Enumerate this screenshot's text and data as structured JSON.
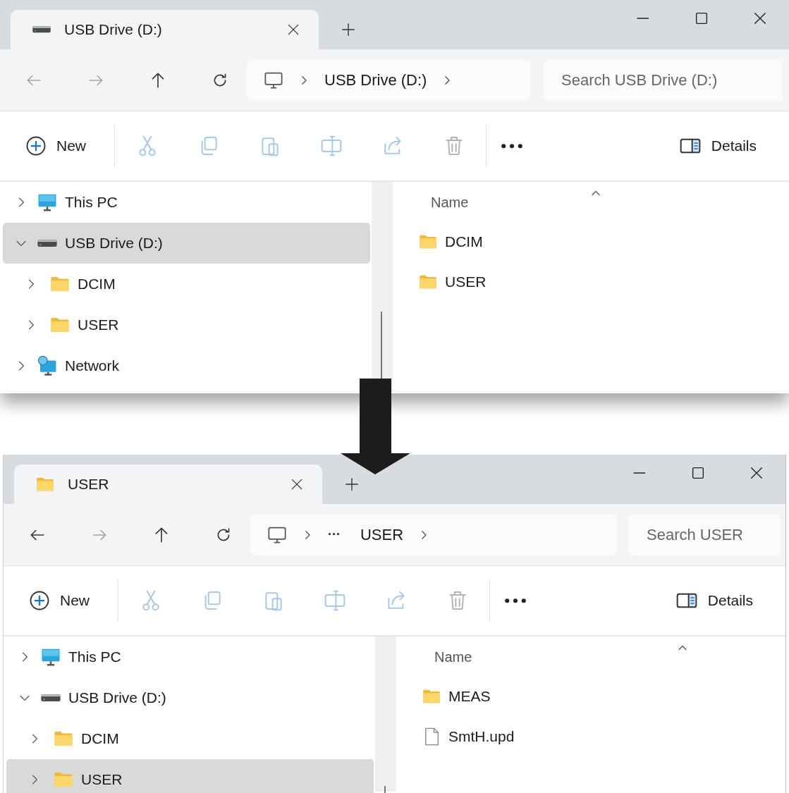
{
  "windows": [
    {
      "tab": {
        "label": "USB Drive (D:)",
        "kind": "drive",
        "selected": true
      },
      "nav_buttons": [
        {
          "kind": "back",
          "disabled": true
        },
        {
          "kind": "forward",
          "disabled": true
        },
        {
          "kind": "up",
          "disabled": false
        },
        {
          "kind": "refresh",
          "disabled": false
        }
      ],
      "address": [
        {
          "kind": "location",
          "label": "USB Drive (D:)"
        }
      ],
      "search": {
        "placeholder": "Search USB Drive (D:)"
      },
      "commands": [
        {
          "kind": "new",
          "label": "New",
          "disabled": false
        },
        {
          "kind": "cut",
          "disabled": true
        },
        {
          "kind": "copy",
          "disabled": true
        },
        {
          "kind": "paste",
          "disabled": true
        },
        {
          "kind": "rename",
          "disabled": true
        },
        {
          "kind": "share",
          "disabled": true
        },
        {
          "kind": "delete",
          "disabled": true
        },
        {
          "kind": "more",
          "disabled": false
        },
        {
          "kind": "details",
          "label": "Details",
          "disabled": false
        }
      ],
      "nav_pane": [
        {
          "label": "This PC",
          "kind": "pc",
          "expanded": false,
          "selected": false
        },
        {
          "label": "USB Drive (D:)",
          "kind": "drive",
          "expanded": true,
          "selected": true,
          "children": [
            {
              "label": "DCIM",
              "kind": "folder",
              "expanded": false,
              "selected": false
            },
            {
              "label": "USER",
              "kind": "folder",
              "expanded": false,
              "selected": false
            }
          ]
        },
        {
          "label": "Network",
          "kind": "network",
          "expanded": false,
          "selected": false
        }
      ],
      "files": {
        "column": "Name",
        "rows": [
          {
            "name": "DCIM",
            "kind": "folder"
          },
          {
            "name": "USER",
            "kind": "folder"
          }
        ]
      }
    },
    {
      "tab": {
        "label": "USER",
        "kind": "folder",
        "selected": true
      },
      "nav_buttons": [
        {
          "kind": "back",
          "disabled": false
        },
        {
          "kind": "forward",
          "disabled": true
        },
        {
          "kind": "up",
          "disabled": false
        },
        {
          "kind": "refresh",
          "disabled": false
        }
      ],
      "address": [
        {
          "kind": "overflow",
          "label": "···"
        },
        {
          "kind": "location",
          "label": "USER"
        }
      ],
      "search": {
        "placeholder": "Search USER"
      },
      "commands": [
        {
          "kind": "new",
          "label": "New",
          "disabled": false
        },
        {
          "kind": "cut",
          "disabled": true
        },
        {
          "kind": "copy",
          "disabled": true
        },
        {
          "kind": "paste",
          "disabled": true
        },
        {
          "kind": "rename",
          "disabled": true
        },
        {
          "kind": "share",
          "disabled": true
        },
        {
          "kind": "delete",
          "disabled": true
        },
        {
          "kind": "more",
          "disabled": false
        },
        {
          "kind": "details",
          "label": "Details",
          "disabled": false
        }
      ],
      "nav_pane": [
        {
          "label": "This PC",
          "kind": "pc",
          "expanded": false,
          "selected": false
        },
        {
          "label": "USB Drive (D:)",
          "kind": "drive",
          "expanded": true,
          "selected": false,
          "children": [
            {
              "label": "DCIM",
              "kind": "folder",
              "expanded": false,
              "selected": false
            },
            {
              "label": "USER",
              "kind": "folder",
              "expanded": false,
              "selected": true
            }
          ]
        }
      ],
      "files": {
        "column": "Name",
        "rows": [
          {
            "name": "MEAS",
            "kind": "folder"
          },
          {
            "name": "SmtH.upd",
            "kind": "file"
          }
        ]
      }
    }
  ]
}
